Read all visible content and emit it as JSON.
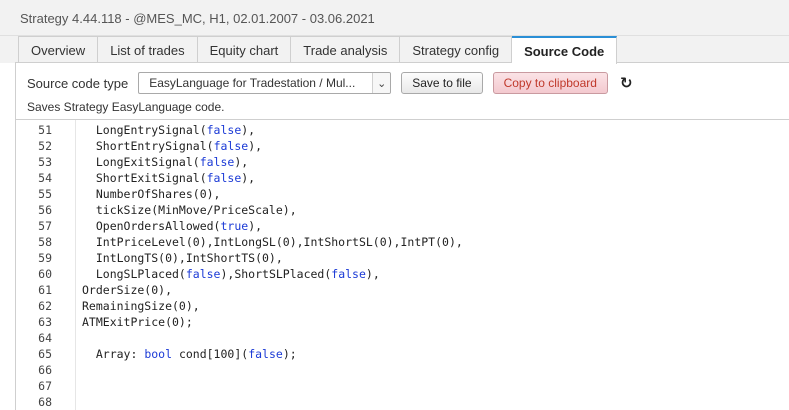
{
  "window": {
    "title": "Strategy 4.44.118 - @MES_MC, H1, 02.01.2007 - 03.06.2021"
  },
  "tabs": [
    {
      "label": "Overview"
    },
    {
      "label": "List of trades"
    },
    {
      "label": "Equity chart"
    },
    {
      "label": "Trade analysis"
    },
    {
      "label": "Strategy config"
    },
    {
      "label": "Source Code",
      "active": true
    }
  ],
  "toolbar": {
    "type_label": "Source code type",
    "type_value": "EasyLanguage for Tradestation / Mul...",
    "save_label": "Save to file",
    "copy_label": "Copy to clipboard",
    "description": "Saves Strategy EasyLanguage code."
  },
  "code_lines": [
    {
      "num": "51",
      "segs": [
        [
          "  LongEntrySignal(",
          ""
        ],
        [
          "false",
          "kw"
        ],
        [
          "),",
          ""
        ]
      ]
    },
    {
      "num": "52",
      "segs": [
        [
          "  ShortEntrySignal(",
          ""
        ],
        [
          "false",
          "kw"
        ],
        [
          "),",
          ""
        ]
      ]
    },
    {
      "num": "53",
      "segs": [
        [
          "  LongExitSignal(",
          ""
        ],
        [
          "false",
          "kw"
        ],
        [
          "),",
          ""
        ]
      ]
    },
    {
      "num": "54",
      "segs": [
        [
          "  ShortExitSignal(",
          ""
        ],
        [
          "false",
          "kw"
        ],
        [
          "),",
          ""
        ]
      ]
    },
    {
      "num": "55",
      "segs": [
        [
          "  NumberOfShares(0),",
          ""
        ]
      ]
    },
    {
      "num": "56",
      "segs": [
        [
          "  tickSize(MinMove/PriceScale),",
          ""
        ]
      ]
    },
    {
      "num": "57",
      "segs": [
        [
          "  OpenOrdersAllowed(",
          ""
        ],
        [
          "true",
          "kw"
        ],
        [
          "),",
          ""
        ]
      ]
    },
    {
      "num": "58",
      "segs": [
        [
          "  IntPriceLevel(0),IntLongSL(0),IntShortSL(0),IntPT(0),",
          ""
        ]
      ]
    },
    {
      "num": "59",
      "segs": [
        [
          "  IntLongTS(0),IntShortTS(0),",
          ""
        ]
      ]
    },
    {
      "num": "60",
      "segs": [
        [
          "  LongSLPlaced(",
          ""
        ],
        [
          "false",
          "kw"
        ],
        [
          "),ShortSLPlaced(",
          ""
        ],
        [
          "false",
          "kw"
        ],
        [
          "),",
          ""
        ]
      ]
    },
    {
      "num": "61",
      "segs": [
        [
          "OrderSize(0),",
          ""
        ]
      ]
    },
    {
      "num": "62",
      "segs": [
        [
          "RemainingSize(0),",
          ""
        ]
      ]
    },
    {
      "num": "63",
      "segs": [
        [
          "ATMExitPrice(0);",
          ""
        ]
      ]
    },
    {
      "num": "64",
      "segs": []
    },
    {
      "num": "65",
      "segs": [
        [
          "  Array: ",
          ""
        ],
        [
          "bool",
          "kw"
        ],
        [
          " cond[100](",
          ""
        ],
        [
          "false",
          "kw"
        ],
        [
          ");",
          ""
        ]
      ]
    },
    {
      "num": "66",
      "segs": []
    },
    {
      "num": "67",
      "segs": []
    },
    {
      "num": "68",
      "segs": []
    }
  ],
  "icons": {
    "dropdown": "chevron-down-icon",
    "refresh": "refresh-icon"
  }
}
